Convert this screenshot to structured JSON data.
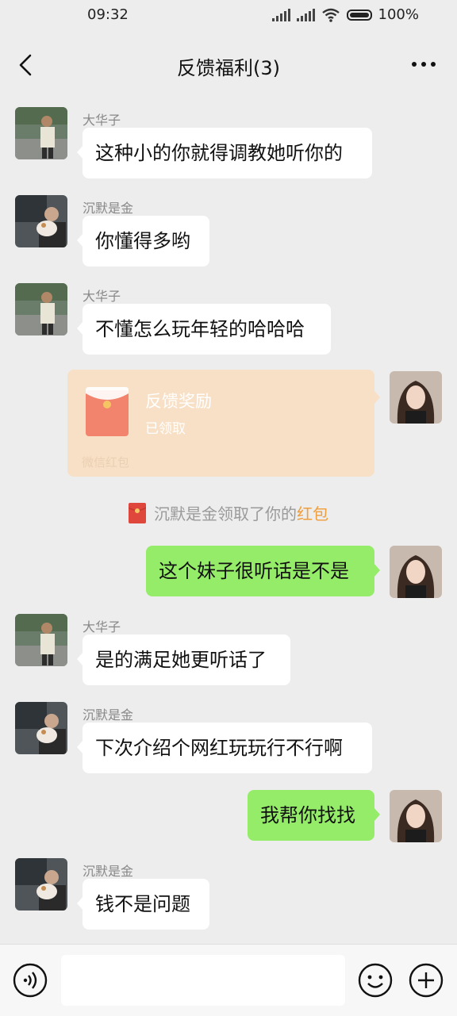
{
  "status_bar": {
    "time": "09:32",
    "battery": "100%"
  },
  "header": {
    "title": "反馈福利(3)",
    "back_icon": "chevron-left-icon",
    "more_icon": "more-dots-icon"
  },
  "messages": [
    {
      "type": "text",
      "side": "left",
      "sender": "大华子",
      "text": "这种小的你就得调教她听你的"
    },
    {
      "type": "text",
      "side": "left",
      "sender": "沉默是金",
      "text": "你懂得多哟"
    },
    {
      "type": "text",
      "side": "left",
      "sender": "大华子",
      "text": "不懂怎么玩年轻的哈哈哈"
    },
    {
      "type": "red_packet",
      "side": "right",
      "title": "反馈奖励",
      "status": "已领取",
      "footer": "微信红包"
    },
    {
      "type": "system",
      "before": "沉默是金领取了你的",
      "link": "红包"
    },
    {
      "type": "text",
      "side": "right",
      "text": "这个妹子很听话是不是"
    },
    {
      "type": "text",
      "side": "left",
      "sender": "大华子",
      "text": "是的满足她更听话了"
    },
    {
      "type": "text",
      "side": "left",
      "sender": "沉默是金",
      "text": "下次介绍个网红玩玩行不行啊"
    },
    {
      "type": "text",
      "side": "right",
      "text": "我帮你找找"
    },
    {
      "type": "text",
      "side": "left",
      "sender": "沉默是金",
      "text": "钱不是问题"
    }
  ],
  "input_bar": {
    "voice_icon": "voice-icon",
    "emoji_icon": "emoji-icon",
    "plus_icon": "plus-icon",
    "input_value": ""
  },
  "colors": {
    "background": "#ededed",
    "self_bubble": "#95ec69",
    "other_bubble": "#ffffff",
    "red_packet_opened": "#f8e0c6",
    "link_orange": "#f09d3b"
  }
}
